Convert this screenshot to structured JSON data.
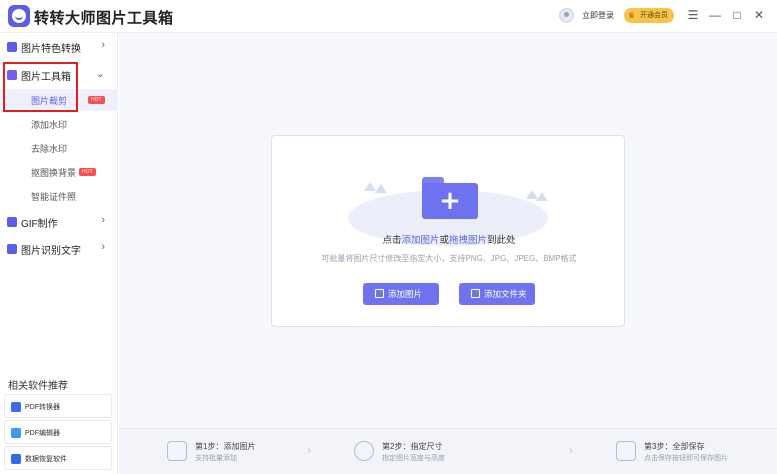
{
  "app": {
    "title": "转转大师图片工具箱",
    "login_label": "立即登录",
    "vip_label": "开通会员",
    "window_controls": {
      "menu": "☰",
      "minimize": "—",
      "maximize": "□",
      "close": "✕"
    }
  },
  "sidebar": {
    "groups": [
      {
        "label": "图片特色转换",
        "icon": "convert-icon",
        "chevron": "›"
      },
      {
        "label": "图片工具箱",
        "icon": "toolbox-icon",
        "chevron": "⌄",
        "expanded": true
      },
      {
        "label": "GIF制作",
        "icon": "gif-icon",
        "chevron": "›"
      },
      {
        "label": "图片识别文字",
        "icon": "ocr-icon",
        "chevron": "›"
      }
    ],
    "toolbox_items": [
      {
        "label": "图片裁剪",
        "active": true,
        "badge": "HOT"
      },
      {
        "label": "添加水印"
      },
      {
        "label": "去除水印"
      },
      {
        "label": "抠图换背景",
        "badge": "HOT"
      },
      {
        "label": "智能证件照"
      }
    ],
    "related_title": "相关软件推荐",
    "related_items": [
      {
        "label": "PDF转换器",
        "icon": "pdf-converter-icon",
        "color": "#3b6cf6"
      },
      {
        "label": "PDF编辑器",
        "icon": "pdf-editor-icon",
        "color": "#3b9cf6"
      },
      {
        "label": "数据恢复软件",
        "icon": "data-recovery-icon",
        "color": "#2f6bf0"
      }
    ]
  },
  "dropzone": {
    "prompt_prefix": "点击",
    "prompt_link1": "添加图片",
    "prompt_mid": "或",
    "prompt_link2": "拖拽图片",
    "prompt_suffix": "到此处",
    "hint": "可批量将图片尺寸修改至指定大小，支持PNG、JPG、JPEG、BMP格式",
    "add_image_button": "添加图片",
    "add_folder_button": "添加文件夹"
  },
  "steps": [
    {
      "title": "第1步：添加图片",
      "desc": "支持批量添加"
    },
    {
      "title": "第2步：指定尺寸",
      "desc": "指定图片宽度与高度"
    },
    {
      "title": "第3步：全部保存",
      "desc": "点击保存按钮即可保存图片"
    }
  ],
  "colors": {
    "accent": "#5b5ee6",
    "button": "#7072ee",
    "hot": "#ff4d4f",
    "vip": "#f7c34a"
  }
}
